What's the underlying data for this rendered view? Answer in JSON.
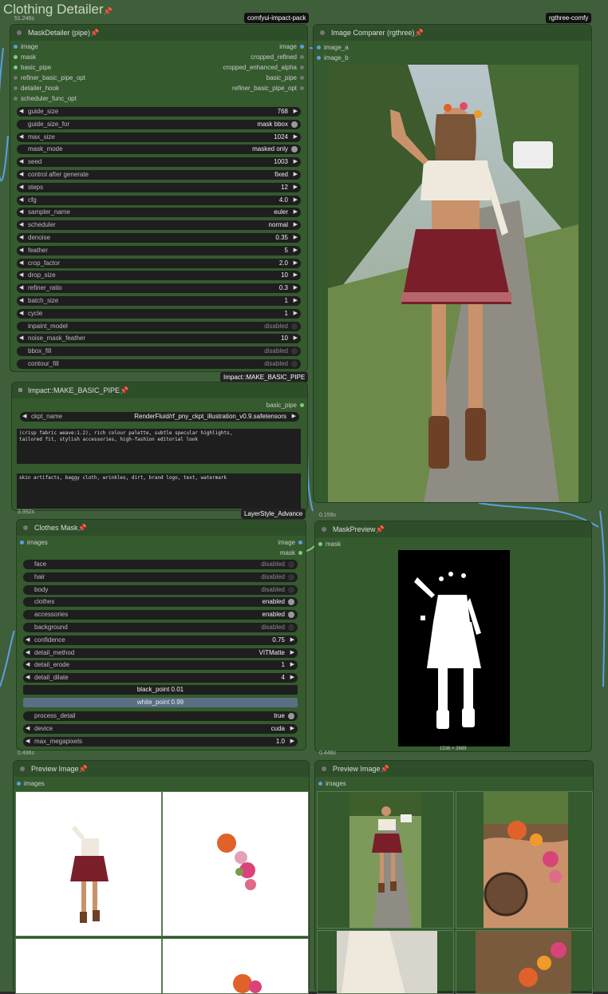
{
  "group": {
    "title": "Clothing Detailer"
  },
  "tags": {
    "impact": "comfyui-impact-pack",
    "rgthree": "rgthree-comfy",
    "make_pipe_overlay": "Impact::MAKE_BASIC_PIPE",
    "layerstyle_overlay": "LayerStyle_Advance"
  },
  "timings": {
    "t1": "51.246s",
    "t2": "0.159s",
    "t3": "3.992s",
    "t4": "0.496s",
    "t5": "0.448s"
  },
  "mask_detailer": {
    "title": "MaskDetailer (pipe)",
    "inputs": [
      "image",
      "mask",
      "basic_pipe",
      "refiner_basic_pipe_opt",
      "detailer_hook",
      "scheduler_func_opt"
    ],
    "outputs": [
      "image",
      "cropped_refined",
      "cropped_enhanced_alpha",
      "basic_pipe",
      "refiner_basic_pipe_opt"
    ],
    "widgets": [
      {
        "label": "guide_size",
        "value": "768",
        "kind": "num"
      },
      {
        "label": "guide_size_for",
        "value": "mask bbox",
        "kind": "toggle_on"
      },
      {
        "label": "max_size",
        "value": "1024",
        "kind": "num"
      },
      {
        "label": "mask_mode",
        "value": "masked only",
        "kind": "toggle_on"
      },
      {
        "label": "seed",
        "value": "1003",
        "kind": "num"
      },
      {
        "label": "control after generate",
        "value": "fixed",
        "kind": "num"
      },
      {
        "label": "steps",
        "value": "12",
        "kind": "num"
      },
      {
        "label": "cfg",
        "value": "4.0",
        "kind": "num"
      },
      {
        "label": "sampler_name",
        "value": "euler",
        "kind": "num"
      },
      {
        "label": "scheduler",
        "value": "normal",
        "kind": "num"
      },
      {
        "label": "denoise",
        "value": "0.35",
        "kind": "num"
      },
      {
        "label": "feather",
        "value": "5",
        "kind": "num"
      },
      {
        "label": "crop_factor",
        "value": "2.0",
        "kind": "num"
      },
      {
        "label": "drop_size",
        "value": "10",
        "kind": "num"
      },
      {
        "label": "refiner_ratio",
        "value": "0.3",
        "kind": "num"
      },
      {
        "label": "batch_size",
        "value": "1",
        "kind": "num"
      },
      {
        "label": "cycle",
        "value": "1",
        "kind": "num"
      },
      {
        "label": "inpaint_model",
        "value": "disabled",
        "kind": "toggle_off"
      },
      {
        "label": "noise_mask_feather",
        "value": "10",
        "kind": "num"
      },
      {
        "label": "bbox_fill",
        "value": "disabled",
        "kind": "toggle_off"
      },
      {
        "label": "contour_fill",
        "value": "disabled",
        "kind": "toggle_off"
      }
    ]
  },
  "image_comparer": {
    "title": "Image Comparer (rgthree)",
    "inputs": [
      "image_a",
      "image_b"
    ]
  },
  "make_basic_pipe": {
    "title": "Impact::MAKE_BASIC_PIPE",
    "output": "basic_pipe",
    "ckpt_label": "ckpt_name",
    "ckpt_value": "RenderFluid/rf_pny_ckpt_illustration_v0.9.safetensors",
    "positive": "(crisp fabric weave:1.2), rich colour palette, subtle specular highlights,\ntailored fit, stylish accessories, high-fashion editorial look",
    "negative": "skin artifacts, baggy cloth, wrinkles, dirt, brand logo, text, watermark"
  },
  "clothes_mask": {
    "title": "Clothes Mask",
    "input": "images",
    "outputs": [
      "image",
      "mask"
    ],
    "widgets": [
      {
        "label": "face",
        "value": "disabled",
        "kind": "toggle_off"
      },
      {
        "label": "hair",
        "value": "disabled",
        "kind": "toggle_off"
      },
      {
        "label": "body",
        "value": "disabled",
        "kind": "toggle_off"
      },
      {
        "label": "clothes",
        "value": "enabled",
        "kind": "toggle_on"
      },
      {
        "label": "accessories",
        "value": "enabled",
        "kind": "toggle_on"
      },
      {
        "label": "background",
        "value": "disabled",
        "kind": "toggle_off"
      },
      {
        "label": "confidence",
        "value": "0.75",
        "kind": "num"
      },
      {
        "label": "detail_method",
        "value": "VITMatte",
        "kind": "num"
      },
      {
        "label": "detail_erode",
        "value": "1",
        "kind": "num"
      },
      {
        "label": "detail_dilate",
        "value": "4",
        "kind": "num"
      }
    ],
    "black_point": "black_point  0.01",
    "white_point": "white_point  0.99",
    "widgets2": [
      {
        "label": "process_detail",
        "value": "true",
        "kind": "toggle_on"
      },
      {
        "label": "device",
        "value": "cuda",
        "kind": "num"
      },
      {
        "label": "max_megapixels",
        "value": "1.0",
        "kind": "num"
      }
    ]
  },
  "mask_preview": {
    "title": "MaskPreview",
    "input": "mask",
    "dims": "1536 × 2688"
  },
  "preview_left": {
    "title": "Preview Image",
    "input": "images"
  },
  "preview_right": {
    "title": "Preview Image",
    "input": "images"
  }
}
